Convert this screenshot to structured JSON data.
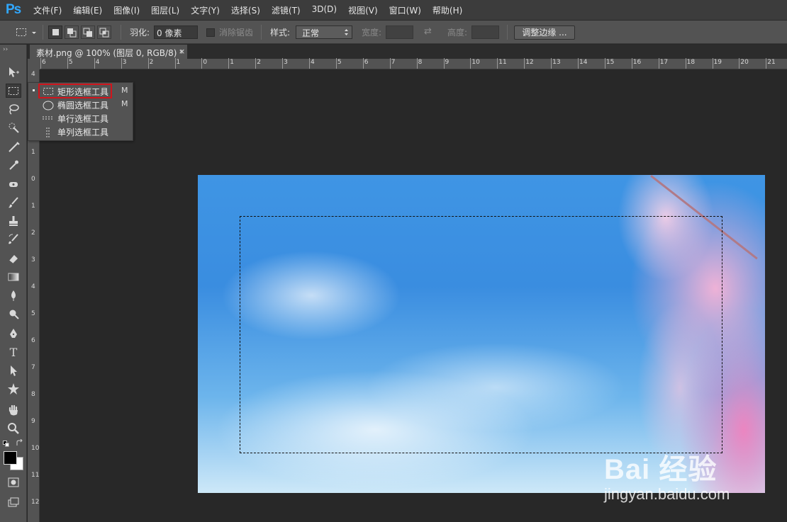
{
  "app": {
    "logo": "Ps"
  },
  "menu": [
    "文件(F)",
    "编辑(E)",
    "图像(I)",
    "图层(L)",
    "文字(Y)",
    "选择(S)",
    "滤镜(T)",
    "3D(D)",
    "视图(V)",
    "窗口(W)",
    "帮助(H)"
  ],
  "options": {
    "feather_label": "羽化:",
    "feather_value": "0 像素",
    "antialias_label": "消除锯齿",
    "style_label": "样式:",
    "style_value": "正常",
    "width_label": "宽度:",
    "height_label": "高度:",
    "refine_edge_button": "调整边缘 ..."
  },
  "document": {
    "tab_title": "素材.png @ 100% (图层 0, RGB/8) *",
    "close_glyph": "×"
  },
  "ruler": {
    "top_ticks": [
      "6",
      "5",
      "4",
      "3",
      "2",
      "1",
      "0",
      "1",
      "2",
      "3",
      "4",
      "5",
      "6",
      "7",
      "8",
      "9",
      "10",
      "11",
      "12",
      "13",
      "14",
      "15",
      "16",
      "17",
      "18",
      "19",
      "20",
      "21"
    ],
    "left_ticks": [
      "4",
      "1",
      "0",
      "1",
      "2",
      "3",
      "4",
      "5",
      "6",
      "7",
      "8",
      "9",
      "10",
      "11",
      "12"
    ]
  },
  "flyout": {
    "items": [
      {
        "label": "矩形选框工具",
        "shortcut": "M",
        "icon": "rect-marquee-icon",
        "active": true
      },
      {
        "label": "椭圆选框工具",
        "shortcut": "M",
        "icon": "ellipse-marquee-icon",
        "active": false
      },
      {
        "label": "单行选框工具",
        "shortcut": "",
        "icon": "single-row-marquee-icon",
        "active": false
      },
      {
        "label": "单列选框工具",
        "shortcut": "",
        "icon": "single-column-marquee-icon",
        "active": false
      }
    ]
  },
  "tools": [
    "move-icon",
    "rect-marquee-icon",
    "lasso-icon",
    "quick-select-icon",
    "crop-icon",
    "eyedropper-icon",
    "spot-healing-icon",
    "brush-icon",
    "clone-stamp-icon",
    "history-brush-icon",
    "eraser-icon",
    "gradient-icon",
    "blur-icon",
    "dodge-icon",
    "pen-icon",
    "type-icon",
    "path-select-icon",
    "custom-shape-icon",
    "hand-icon",
    "zoom-icon"
  ],
  "watermark": {
    "brand": "Bai 经验",
    "url": "jingyan.baidu.com"
  },
  "colors": {
    "accent_blue": "#31a8ff",
    "highlight_red": "#d0141c",
    "foreground": "#000000",
    "background": "#ffffff"
  }
}
